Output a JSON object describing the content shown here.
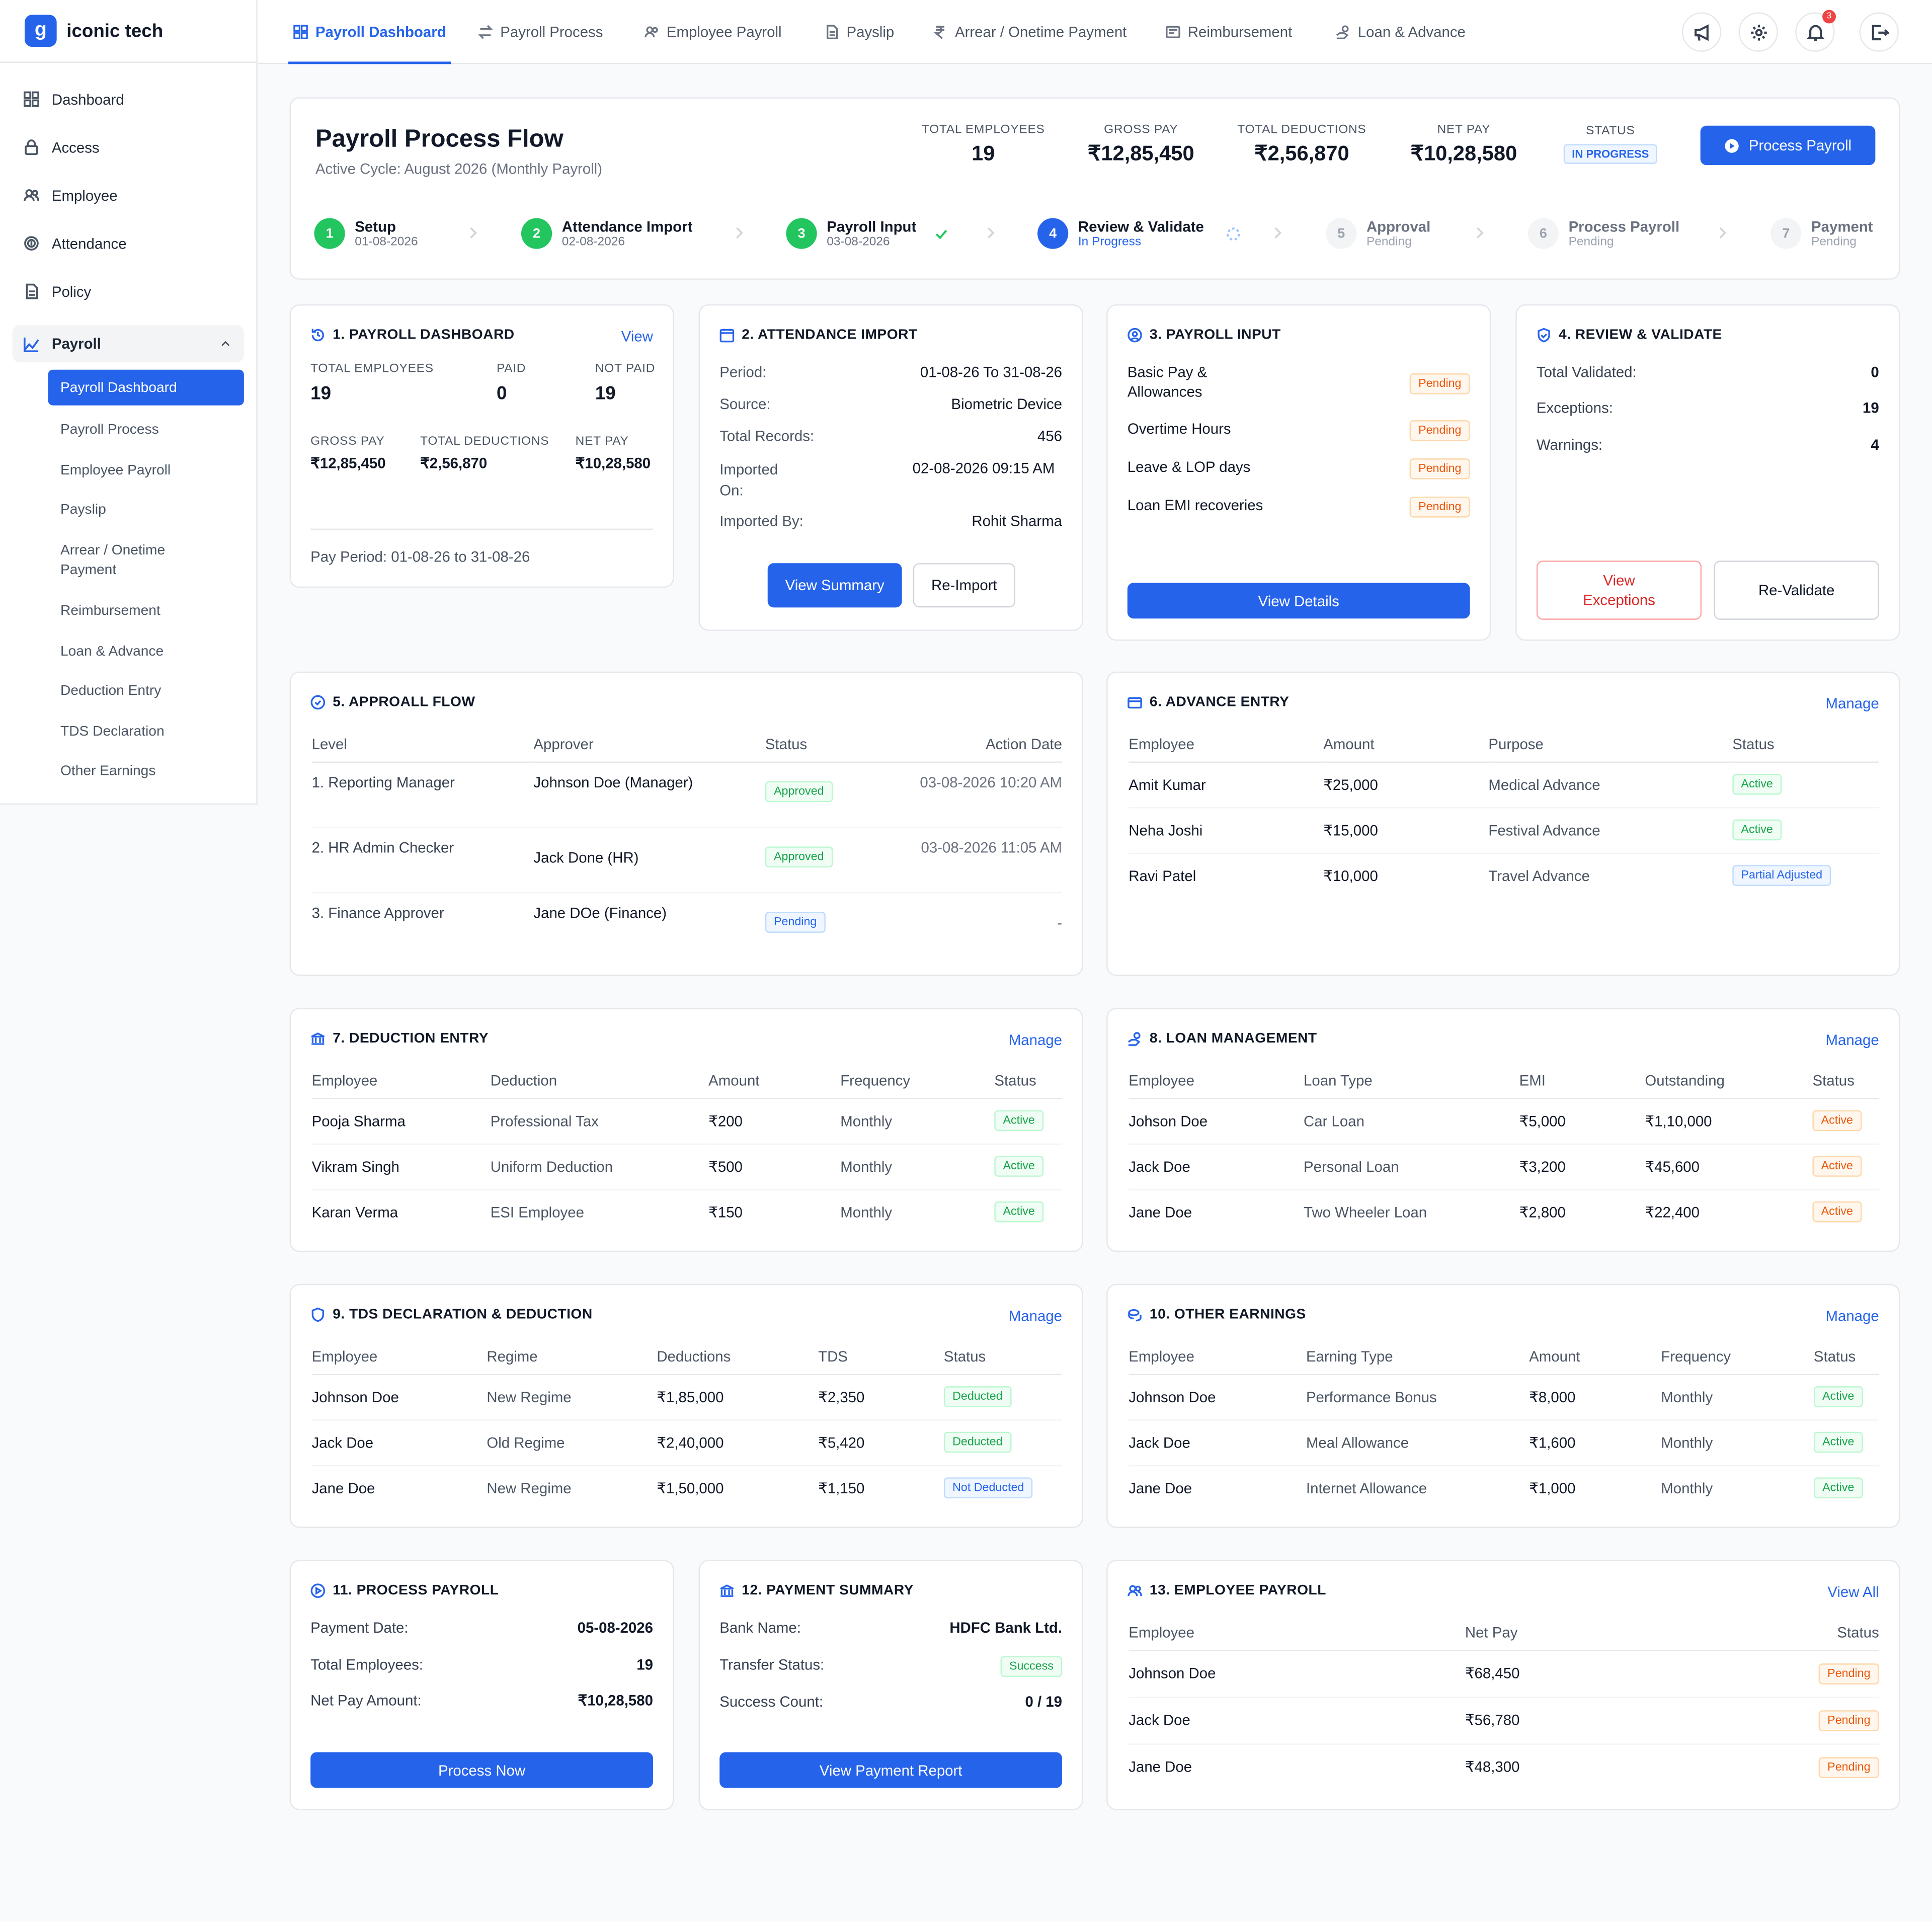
{
  "brand": {
    "logo_letter": "g",
    "name": "iconic tech"
  },
  "sidebar": {
    "items": [
      {
        "label": "Dashboard",
        "icon": "grid-icon"
      },
      {
        "label": "Access",
        "icon": "lock-icon"
      },
      {
        "label": "Employee",
        "icon": "users-icon"
      },
      {
        "label": "Attendance",
        "icon": "fingerprint-icon"
      },
      {
        "label": "Policy",
        "icon": "document-icon"
      }
    ],
    "group": {
      "label": "Payroll",
      "icon": "chart-icon"
    },
    "sub": [
      "Payroll Dashboard",
      "Payroll Process",
      "Employee Payroll",
      "Payslip",
      "Arrear / Onetime Payment",
      "Reimbursement",
      "Loan & Advance",
      "Deduction Entry",
      "TDS Declaration",
      "Other Earnings"
    ]
  },
  "tabs": [
    "Payroll Dashboard",
    "Payroll Process",
    "Employee Payroll",
    "Payslip",
    "Arrear / Onetime Payment",
    "Reimbursement",
    "Loan & Advance"
  ],
  "notif_count": "3",
  "header": {
    "title": "Payroll Process Flow",
    "subtitle": "Active Cycle: August 2026 (Monthly Payroll)",
    "stats": [
      {
        "label": "TOTAL EMPLOYEES",
        "value": "19"
      },
      {
        "label": "GROSS PAY",
        "value": "₹12,85,450"
      },
      {
        "label": "TOTAL DEDUCTIONS",
        "value": "₹2,56,870"
      },
      {
        "label": "NET PAY",
        "value": "₹10,28,580"
      }
    ],
    "status_label": "STATUS",
    "status_value": "IN PROGRESS",
    "process_button": "Process Payroll"
  },
  "steps": [
    {
      "n": "1",
      "title": "Setup",
      "sub": "01-08-2026"
    },
    {
      "n": "2",
      "title": "Attendance Import",
      "sub": "02-08-2026"
    },
    {
      "n": "3",
      "title": "Payroll Input",
      "sub": "03-08-2026"
    },
    {
      "n": "4",
      "title": "Review & Validate",
      "sub": "In Progress"
    },
    {
      "n": "5",
      "title": "Approval",
      "sub": "Pending"
    },
    {
      "n": "6",
      "title": "Process Payroll",
      "sub": "Pending"
    },
    {
      "n": "7",
      "title": "Payment",
      "sub": "Pending"
    }
  ],
  "c1": {
    "title": "1. PAYROLL DASHBOARD",
    "link": "View",
    "l1": "TOTAL EMPLOYEES",
    "v1": "19",
    "l2": "PAID",
    "v2": "0",
    "l3": "NOT PAID",
    "v3": "19",
    "l4": "GROSS PAY",
    "v4": "₹12,85,450",
    "l5": "TOTAL DEDUCTIONS",
    "v5": "₹2,56,870",
    "l6": "NET PAY",
    "v6": "₹10,28,580",
    "period": "Pay Period: 01-08-26 to 31-08-26"
  },
  "c2": {
    "title": "2. ATTENDANCE IMPORT",
    "rows": [
      {
        "k": "Period:",
        "v": "01-08-26 To 31-08-26"
      },
      {
        "k": "Source:",
        "v": "Biometric Device"
      },
      {
        "k": "Total Records:",
        "v": "456"
      },
      {
        "k": "Imported On:",
        "v": "02-08-2026 09:15 AM"
      },
      {
        "k": "Imported By:",
        "v": "Rohit Sharma"
      }
    ],
    "btn1": "View Summary",
    "btn2": "Re-Import"
  },
  "c3": {
    "title": "3. PAYROLL INPUT",
    "rows": [
      {
        "k": "Basic Pay & Allowances",
        "s": "Pending"
      },
      {
        "k": "Overtime Hours",
        "s": "Pending"
      },
      {
        "k": "Leave & LOP days",
        "s": "Pending"
      },
      {
        "k": "Loan EMI recoveries",
        "s": "Pending"
      }
    ],
    "btn": "View Details"
  },
  "c4": {
    "title": "4. REVIEW & VALIDATE",
    "rows": [
      {
        "k": "Total Validated:",
        "v": "0"
      },
      {
        "k": "Exceptions:",
        "v": "19"
      },
      {
        "k": "Warnings:",
        "v": "4"
      }
    ],
    "btn1": "View Exceptions",
    "btn2": "Re-Validate"
  },
  "c5": {
    "title": "5. APPROALL FLOW",
    "headers": [
      "Level",
      "Approver",
      "Status",
      "Action Date"
    ],
    "rows": [
      [
        "1. Reporting Manager",
        "Johnson Doe (Manager)",
        "Approved",
        "03-08-2026 10:20 AM"
      ],
      [
        "2. HR Admin Checker",
        "Jack Done (HR)",
        "Approved",
        "03-08-2026 11:05 AM"
      ],
      [
        "3. Finance Approver",
        "Jane DOe (Finance)",
        "Pending",
        "-"
      ]
    ]
  },
  "c6": {
    "title": "6. ADVANCE ENTRY",
    "link": "Manage",
    "headers": [
      "Employee",
      "Amount",
      "Purpose",
      "Status"
    ],
    "rows": [
      [
        "Amit Kumar",
        "₹25,000",
        "Medical Advance",
        "Active"
      ],
      [
        "Neha Joshi",
        "₹15,000",
        "Festival Advance",
        "Active"
      ],
      [
        "Ravi Patel",
        "₹10,000",
        "Travel Advance",
        "Partial Adjusted"
      ]
    ]
  },
  "c7": {
    "title": "7. DEDUCTION ENTRY",
    "link": "Manage",
    "headers": [
      "Employee",
      "Deduction",
      "Amount",
      "Frequency",
      "Status"
    ],
    "rows": [
      [
        "Pooja Sharma",
        "Professional Tax",
        "₹200",
        "Monthly",
        "Active"
      ],
      [
        "Vikram Singh",
        "Uniform Deduction",
        "₹500",
        "Monthly",
        "Active"
      ],
      [
        "Karan Verma",
        "ESI Employee",
        "₹150",
        "Monthly",
        "Active"
      ]
    ]
  },
  "c8": {
    "title": "8. LOAN MANAGEMENT",
    "link": "Manage",
    "headers": [
      "Employee",
      "Loan Type",
      "EMI",
      "Outstanding",
      "Status"
    ],
    "rows": [
      [
        "Johson Doe",
        "Car Loan",
        "₹5,000",
        "₹1,10,000",
        "Active"
      ],
      [
        "Jack Doe",
        "Personal Loan",
        "₹3,200",
        "₹45,600",
        "Active"
      ],
      [
        "Jane Doe",
        "Two Wheeler Loan",
        "₹2,800",
        "₹22,400",
        "Active"
      ]
    ]
  },
  "c9": {
    "title": "9. TDS DECLARATION & DEDUCTION",
    "link": "Manage",
    "headers": [
      "Employee",
      "Regime",
      "Deductions",
      "TDS",
      "Status"
    ],
    "rows": [
      [
        "Johnson Doe",
        "New Regime",
        "₹1,85,000",
        "₹2,350",
        "Deducted"
      ],
      [
        "Jack Doe",
        "Old Regime",
        "₹2,40,000",
        "₹5,420",
        "Deducted"
      ],
      [
        "Jane Doe",
        "New Regime",
        "₹1,50,000",
        "₹1,150",
        "Not Deducted"
      ]
    ]
  },
  "c10": {
    "title": "10. OTHER EARNINGS",
    "link": "Manage",
    "headers": [
      "Employee",
      "Earning Type",
      "Amount",
      "Frequency",
      "Status"
    ],
    "rows": [
      [
        "Johnson Doe",
        "Performance Bonus",
        "₹8,000",
        "Monthly",
        "Active"
      ],
      [
        "Jack Doe",
        "Meal Allowance",
        "₹1,600",
        "Monthly",
        "Active"
      ],
      [
        "Jane Doe",
        "Internet Allowance",
        "₹1,000",
        "Monthly",
        "Active"
      ]
    ]
  },
  "c11": {
    "title": "11. PROCESS PAYROLL",
    "rows": [
      {
        "k": "Payment Date:",
        "v": "05-08-2026"
      },
      {
        "k": "Total Employees:",
        "v": "19"
      },
      {
        "k": "Net Pay Amount:",
        "v": "₹10,28,580"
      }
    ],
    "btn": "Process Now"
  },
  "c12": {
    "title": "12. PAYMENT SUMMARY",
    "rows": [
      {
        "k": "Bank Name:",
        "v": "HDFC Bank Ltd."
      },
      {
        "k": "Transfer Status:",
        "v": "Success"
      },
      {
        "k": "Success Count:",
        "v": "0 / 19"
      }
    ],
    "btn": "View Payment Report"
  },
  "c13": {
    "title": "13. EMPLOYEE PAYROLL",
    "link": "View All",
    "headers": [
      "Employee",
      "Net Pay",
      "Status"
    ],
    "rows": [
      [
        "Johnson Doe",
        "₹68,450",
        "Pending"
      ],
      [
        "Jack Doe",
        "₹56,780",
        "Pending"
      ],
      [
        "Jane Doe",
        "₹48,300",
        "Pending"
      ]
    ]
  },
  "colors": {
    "primary": "#2563eb",
    "success": "#22c55e",
    "warning": "#ea580c",
    "danger": "#dc2626"
  }
}
